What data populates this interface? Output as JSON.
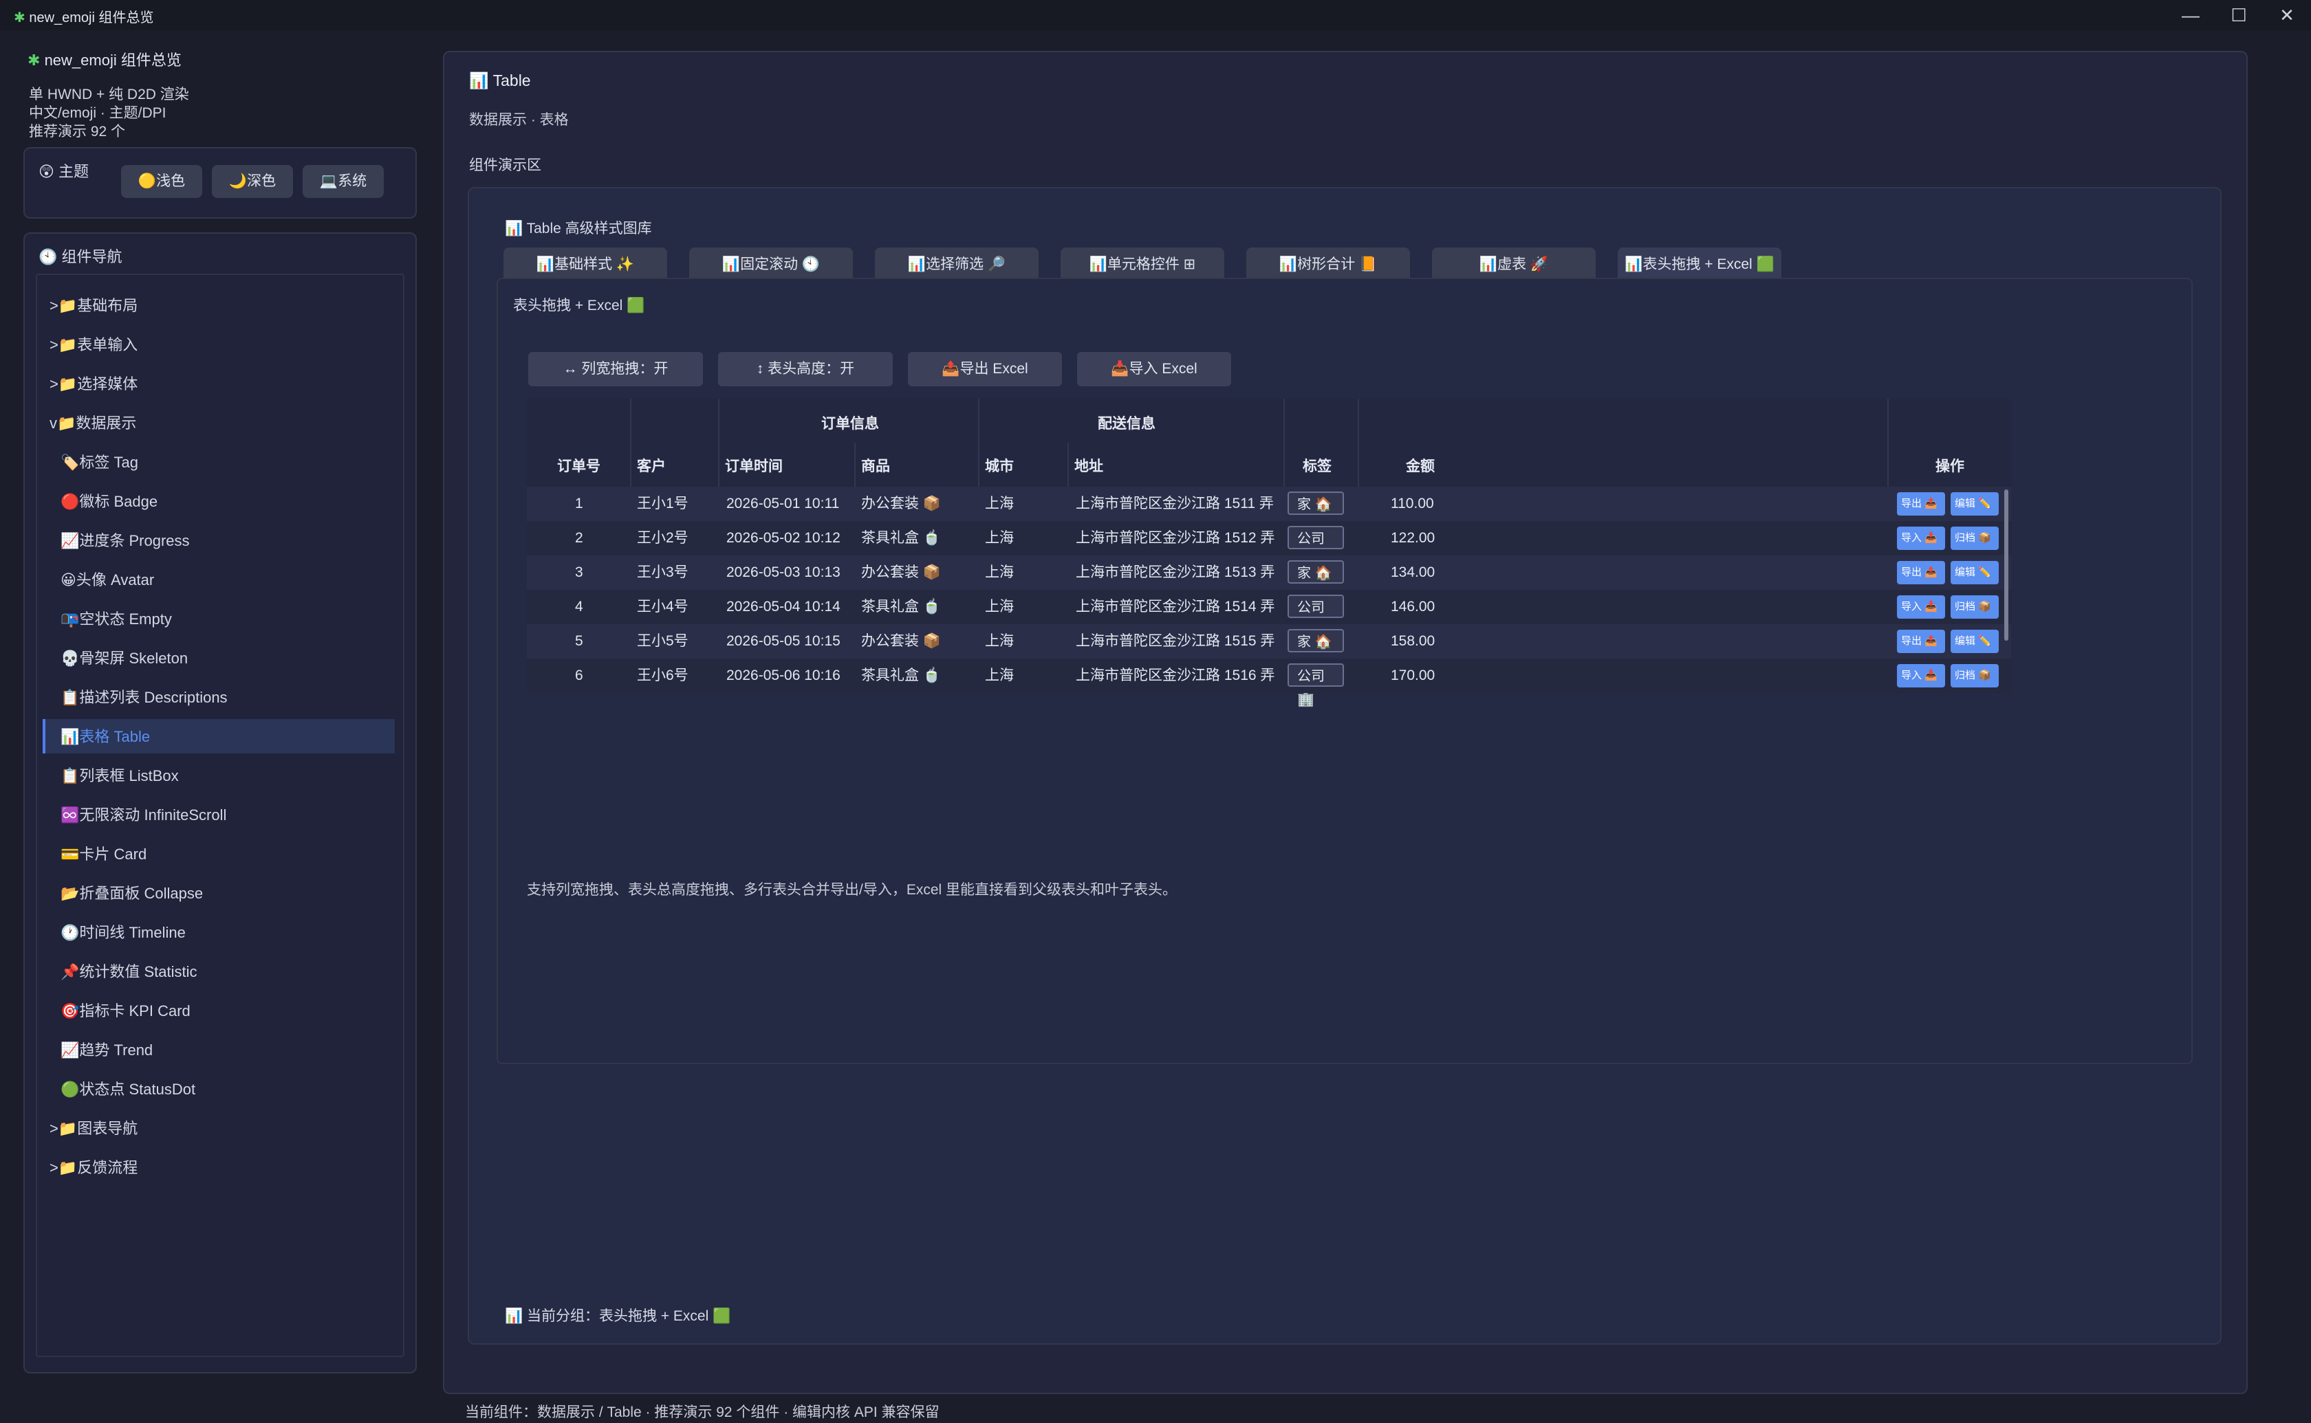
{
  "window": {
    "title": "new_emoji 组件总览",
    "controls": [
      "—",
      "☐",
      "✕"
    ]
  },
  "sidebar": {
    "app_title": "new_emoji 组件总览",
    "info_lines": [
      "单 HWND + 纯 D2D 渲染",
      "中文/emoji · 主题/DPI",
      "推荐演示 92 个"
    ],
    "theme_label": "主题",
    "theme_buttons": [
      "浅色",
      "深色",
      "系统"
    ],
    "nav_title": "组件导航",
    "nav_items": [
      {
        "label": ">📁基础布局",
        "sub": false
      },
      {
        "label": ">📁表单输入",
        "sub": false
      },
      {
        "label": ">📁选择媒体",
        "sub": false
      },
      {
        "label": "v📁数据展示",
        "sub": false
      },
      {
        "label": "🏷️标签 Tag",
        "sub": true
      },
      {
        "label": "🔴徽标 Badge",
        "sub": true
      },
      {
        "label": "📈进度条 Progress",
        "sub": true
      },
      {
        "label": "😀头像 Avatar",
        "sub": true
      },
      {
        "label": "📭空状态 Empty",
        "sub": true
      },
      {
        "label": "💀骨架屏 Skeleton",
        "sub": true
      },
      {
        "label": "📋描述列表 Descriptions",
        "sub": true
      },
      {
        "label": "📊表格 Table",
        "sub": true,
        "active": true
      },
      {
        "label": "📋列表框 ListBox",
        "sub": true
      },
      {
        "label": "♾️无限滚动 InfiniteScroll",
        "sub": true
      },
      {
        "label": "💳卡片 Card",
        "sub": true
      },
      {
        "label": "📂折叠面板 Collapse",
        "sub": true
      },
      {
        "label": "🕐时间线 Timeline",
        "sub": true
      },
      {
        "label": "📌统计数值 Statistic",
        "sub": true
      },
      {
        "label": "🎯指标卡 KPI Card",
        "sub": true
      },
      {
        "label": "📈趋势 Trend",
        "sub": true
      },
      {
        "label": "🟢状态点 StatusDot",
        "sub": true
      },
      {
        "label": ">📁图表导航",
        "sub": false
      },
      {
        "label": ">📁反馈流程",
        "sub": false
      }
    ]
  },
  "main": {
    "title": "📊 Table",
    "subtitle": "数据展示 · 表格",
    "demo_label": "组件演示区",
    "gallery_title": "📊 Table 高级样式图库",
    "tabs": [
      "📊基础样式 ✨",
      "📊固定滚动 🕙",
      "📊选择筛选 🔎",
      "📊单元格控件 ⊞",
      "📊树形合计 📙",
      "📊虚表 🚀",
      "📊表头拖拽 + Excel 🟩"
    ],
    "active_tab_index": 6,
    "panel_title": "表头拖拽 + Excel 🟩",
    "actions": [
      "↔ 列宽拖拽：开",
      "↕ 表头高度：开",
      "📤导出 Excel",
      "📥导入 Excel"
    ],
    "table": {
      "group_headers": [
        "订单信息",
        "配送信息"
      ],
      "columns": [
        "订单号",
        "客户",
        "订单时间",
        "商品",
        "城市",
        "地址",
        "标签",
        "金额",
        "操作"
      ],
      "rows": [
        {
          "id": "1",
          "customer": "王小1号",
          "time": "2026-05-01 10:11",
          "product": "办公套装 📦",
          "city": "上海",
          "address": "上海市普陀区金沙江路 1511 弄",
          "tag": "家 🏠",
          "amount": "110.00",
          "op1": "导出 📤",
          "op2": "编辑 ✏️"
        },
        {
          "id": "2",
          "customer": "王小2号",
          "time": "2026-05-02 10:12",
          "product": "茶具礼盒 🍵",
          "city": "上海",
          "address": "上海市普陀区金沙江路 1512 弄",
          "tag": "公司 🏢",
          "amount": "122.00",
          "op1": "导入 📥",
          "op2": "归档 📦"
        },
        {
          "id": "3",
          "customer": "王小3号",
          "time": "2026-05-03 10:13",
          "product": "办公套装 📦",
          "city": "上海",
          "address": "上海市普陀区金沙江路 1513 弄",
          "tag": "家 🏠",
          "amount": "134.00",
          "op1": "导出 📤",
          "op2": "编辑 ✏️"
        },
        {
          "id": "4",
          "customer": "王小4号",
          "time": "2026-05-04 10:14",
          "product": "茶具礼盒 🍵",
          "city": "上海",
          "address": "上海市普陀区金沙江路 1514 弄",
          "tag": "公司 🏢",
          "amount": "146.00",
          "op1": "导入 📥",
          "op2": "归档 📦"
        },
        {
          "id": "5",
          "customer": "王小5号",
          "time": "2026-05-05 10:15",
          "product": "办公套装 📦",
          "city": "上海",
          "address": "上海市普陀区金沙江路 1515 弄",
          "tag": "家 🏠",
          "amount": "158.00",
          "op1": "导出 📤",
          "op2": "编辑 ✏️"
        },
        {
          "id": "6",
          "customer": "王小6号",
          "time": "2026-05-06 10:16",
          "product": "茶具礼盒 🍵",
          "city": "上海",
          "address": "上海市普陀区金沙江路 1516 弄",
          "tag": "公司 🏢",
          "amount": "170.00",
          "op1": "导入 📥",
          "op2": "归档 📦"
        }
      ]
    },
    "description": "支持列宽拖拽、表头总高度拖拽、多行表头合并导出/导入，Excel 里能直接看到父级表头和叶子表头。",
    "current_group": "📊 当前分组：表头拖拽 + Excel 🟩"
  },
  "status_bar": "当前组件：数据展示 / Table · 推荐演示 92 个组件 · 编辑内核 API 兼容保留",
  "colors": {
    "background": "#1b1d2a",
    "panel": "#22253c",
    "accent": "#5b8ff0",
    "active_nav": "#2a3558"
  }
}
